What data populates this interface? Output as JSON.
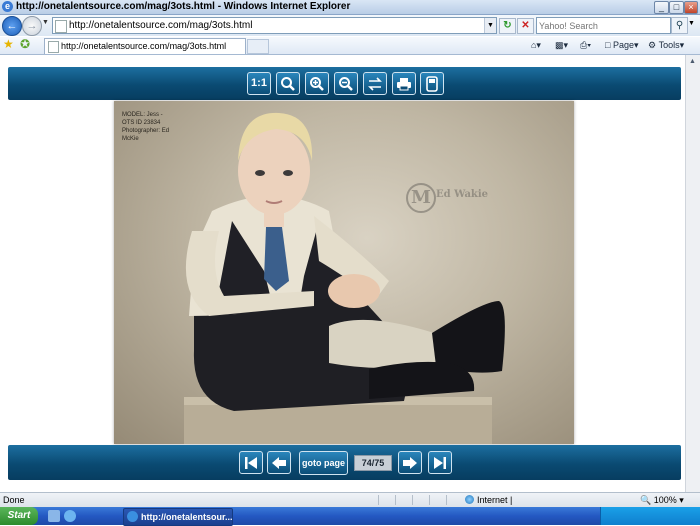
{
  "window": {
    "title": "http://onetalentsource.com/mag/3ots.html - Windows Internet Explorer",
    "controls": [
      "_",
      "□",
      "×"
    ]
  },
  "address_bar": {
    "url": "http://onetalentsource.com/mag/3ots.html",
    "search_placeholder": "Yahoo! Search"
  },
  "tabs": [
    {
      "label": "http://onetalentsource.com/mag/3ots.html",
      "active": true
    }
  ],
  "command_bar": {
    "page_label": "Page",
    "tools_label": "Tools"
  },
  "viewer": {
    "top_toolbar": [
      {
        "name": "actual-size",
        "label": "1:1"
      },
      {
        "name": "zoom-fit",
        "icon": "magnifier-icon"
      },
      {
        "name": "zoom-in",
        "icon": "zoom-in-icon"
      },
      {
        "name": "zoom-out",
        "icon": "zoom-out-icon"
      },
      {
        "name": "rotate",
        "icon": "swap-icon"
      },
      {
        "name": "print",
        "icon": "printer-icon"
      },
      {
        "name": "save",
        "icon": "disk-icon"
      }
    ],
    "photo_caption": "MODEL: Jess -\nOTS ID 23834\nPhotographer: Ed\nMcKie",
    "watermark": "Ed Wakie",
    "goto_label": "goto page",
    "page_indicator": "74/75"
  },
  "status_bar": {
    "status": "Done",
    "zone": "Internet |",
    "zoom": "100%"
  },
  "taskbar": {
    "start_label": "Start",
    "task_label": "http://onetalentsour..."
  },
  "colors": {
    "toolbar_blue": "#0a4a72",
    "taskbar_blue": "#2458c2"
  }
}
